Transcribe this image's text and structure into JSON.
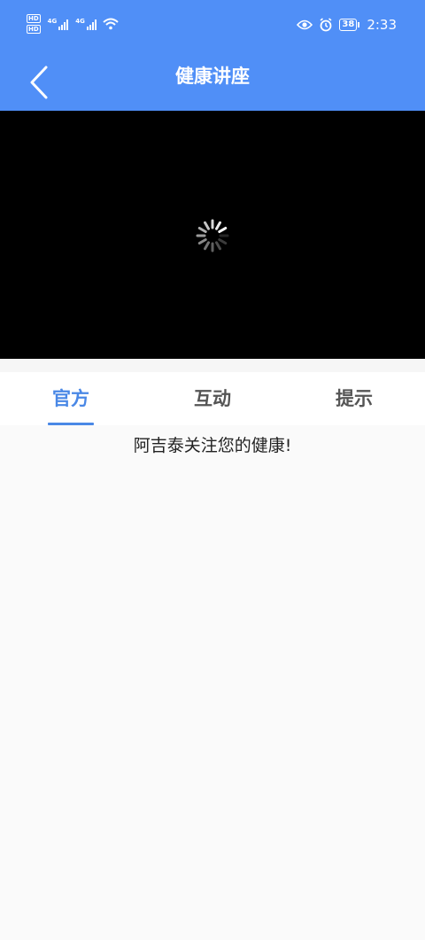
{
  "status_bar": {
    "network_1": "4G",
    "network_2": "4G",
    "battery": "38",
    "time": "2:33"
  },
  "nav": {
    "title": "健康讲座",
    "back_icon": "chevron-left-icon"
  },
  "video": {
    "state_icon": "loading-spinner-icon"
  },
  "tabs": [
    {
      "label": "官方",
      "active": true
    },
    {
      "label": "互动",
      "active": false
    },
    {
      "label": "提示",
      "active": false
    }
  ],
  "content": {
    "message": "阿吉泰关注您的健康!"
  },
  "colors": {
    "header_bg": "#508ff7",
    "tab_active": "#4a88e6",
    "video_bg": "#000000"
  }
}
